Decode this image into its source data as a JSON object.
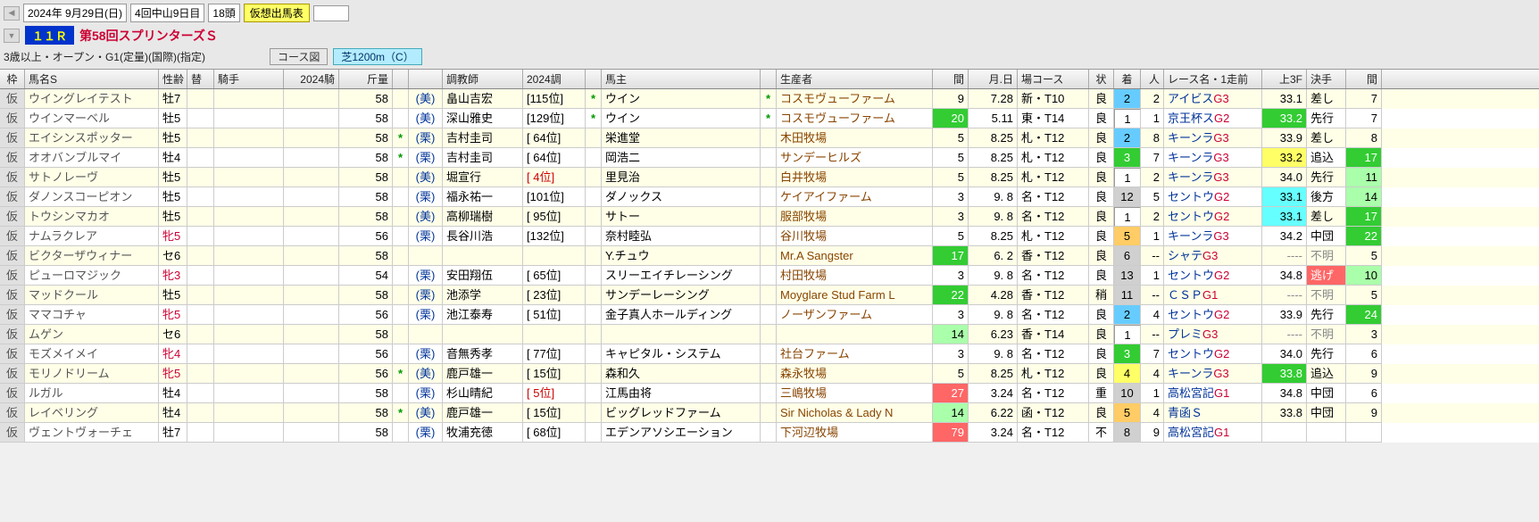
{
  "header": {
    "date": "2024年 9月29日(日)",
    "meeting": "4回中山9日目",
    "horses": "18頭",
    "badge": "仮想出馬表",
    "race_num": "１１Ｒ",
    "race_name": "第58回スプリンターズＳ",
    "race_cond": "3歳以上・オープン・G1(定量)(国際)(指定)",
    "course_btn": "コース図",
    "course": "芝1200m（C）"
  },
  "columns": {
    "waku": "枠",
    "name": "馬名S",
    "sexage": "性齢",
    "chg": "替",
    "jockey": "騎手",
    "jrank": "2024騎",
    "weight": "斤量",
    "trainer": "調教師",
    "trank": "2024調",
    "owner": "馬主",
    "breeder": "生産者",
    "gap": "間",
    "date": "月.日",
    "course": "場コース",
    "cond": "状",
    "fin": "着",
    "pop": "人",
    "race": "レース名・1走前",
    "f3": "上3F",
    "style": "決手",
    "gap2": "間"
  },
  "rows": [
    {
      "name": "ウイングレイテスト",
      "sex": "牡7",
      "wt": "58",
      "star1": "",
      "loc": "(美)",
      "tr": "畠山吉宏",
      "trk": "[115位]",
      "star2": "*",
      "own": "ウイン",
      "star3": "*",
      "brd": "コスモヴューファーム",
      "gap": "9",
      "gapc": "",
      "date": "7.28",
      "crs": "新・T10",
      "cond": "良",
      "fin": "2",
      "finc": "fin-2",
      "pop": "2",
      "race": "アイビス",
      "rg": "G3",
      "f3": "33.1",
      "f3c": "f3-plain",
      "sty": "差し",
      "styc": "",
      "g2": "7",
      "g2c": ""
    },
    {
      "name": "ウインマーベル",
      "sex": "牡5",
      "wt": "58",
      "star1": "",
      "loc": "(美)",
      "tr": "深山雅史",
      "trk": "[129位]",
      "star2": "*",
      "own": "ウイン",
      "star3": "*",
      "brd": "コスモヴューファーム",
      "gap": "20",
      "gapc": "bg-green",
      "date": "5.11",
      "crs": "東・T14",
      "cond": "良",
      "fin": "1",
      "finc": "fin-1",
      "pop": "1",
      "race": "京王杯ス",
      "rg": "G2",
      "f3": "33.2",
      "f3c": "f3-green",
      "sty": "先行",
      "styc": "",
      "g2": "7",
      "g2c": ""
    },
    {
      "name": "エイシンスポッター",
      "sex": "牡5",
      "wt": "58",
      "star1": "*",
      "loc": "(栗)",
      "tr": "吉村圭司",
      "trk": "[ 64位]",
      "star2": "",
      "own": "栄進堂",
      "star3": "",
      "brd": "木田牧場",
      "gap": "5",
      "gapc": "",
      "date": "8.25",
      "crs": "札・T12",
      "cond": "良",
      "fin": "2",
      "finc": "fin-2",
      "pop": "8",
      "race": "キーンラ",
      "rg": "G3",
      "f3": "33.9",
      "f3c": "f3-plain",
      "sty": "差し",
      "styc": "",
      "g2": "8",
      "g2c": ""
    },
    {
      "name": "オオバンブルマイ",
      "sex": "牡4",
      "wt": "58",
      "star1": "*",
      "loc": "(栗)",
      "tr": "吉村圭司",
      "trk": "[ 64位]",
      "star2": "",
      "own": "岡浩二",
      "star3": "",
      "brd": "サンデーヒルズ",
      "gap": "5",
      "gapc": "",
      "date": "8.25",
      "crs": "札・T12",
      "cond": "良",
      "fin": "3",
      "finc": "fin-3",
      "pop": "7",
      "race": "キーンラ",
      "rg": "G3",
      "f3": "33.2",
      "f3c": "f3-yellow",
      "sty": "追込",
      "styc": "",
      "g2": "17",
      "g2c": "g2-dgreen"
    },
    {
      "name": "サトノレーヴ",
      "sex": "牡5",
      "wt": "58",
      "star1": "",
      "loc": "(美)",
      "tr": "堀宣行",
      "trk": "[  4位]",
      "trkc": "trank-red",
      "star2": "",
      "own": "里見治",
      "star3": "",
      "brd": "白井牧場",
      "gap": "5",
      "gapc": "",
      "date": "8.25",
      "crs": "札・T12",
      "cond": "良",
      "fin": "1",
      "finc": "fin-1",
      "pop": "2",
      "race": "キーンラ",
      "rg": "G3",
      "f3": "34.0",
      "f3c": "f3-plain",
      "sty": "先行",
      "styc": "",
      "g2": "11",
      "g2c": "g2-green"
    },
    {
      "name": "ダノンスコーピオン",
      "sex": "牡5",
      "wt": "58",
      "star1": "",
      "loc": "(栗)",
      "tr": "福永祐一",
      "trk": "[101位]",
      "star2": "",
      "own": "ダノックス",
      "star3": "",
      "brd": "ケイアイファーム",
      "gap": "3",
      "gapc": "",
      "date": "9. 8",
      "crs": "名・T12",
      "cond": "良",
      "fin": "12",
      "finc": "fin-other",
      "pop": "5",
      "race": "セントウ",
      "rg": "G2",
      "f3": "33.1",
      "f3c": "f3-cyan",
      "sty": "後方",
      "styc": "",
      "g2": "14",
      "g2c": "g2-green"
    },
    {
      "name": "トウシンマカオ",
      "sex": "牡5",
      "wt": "58",
      "star1": "",
      "loc": "(美)",
      "tr": "高柳瑞樹",
      "trk": "[ 95位]",
      "star2": "",
      "own": "サトー",
      "star3": "",
      "brd": "服部牧場",
      "gap": "3",
      "gapc": "",
      "date": "9. 8",
      "crs": "名・T12",
      "cond": "良",
      "fin": "1",
      "finc": "fin-1",
      "pop": "2",
      "race": "セントウ",
      "rg": "G2",
      "f3": "33.1",
      "f3c": "f3-cyan",
      "sty": "差し",
      "styc": "",
      "g2": "17",
      "g2c": "g2-dgreen"
    },
    {
      "name": "ナムラクレア",
      "sex": "牝5",
      "sexc": "sex-f",
      "wt": "56",
      "star1": "",
      "loc": "(栗)",
      "tr": "長谷川浩",
      "trk": "[132位]",
      "star2": "",
      "own": "奈村睦弘",
      "star3": "",
      "brd": "谷川牧場",
      "gap": "5",
      "gapc": "",
      "date": "8.25",
      "crs": "札・T12",
      "cond": "良",
      "fin": "5",
      "finc": "fin-5",
      "pop": "1",
      "race": "キーンラ",
      "rg": "G3",
      "f3": "34.2",
      "f3c": "f3-plain",
      "sty": "中団",
      "styc": "",
      "g2": "22",
      "g2c": "g2-dgreen"
    },
    {
      "name": "ビクターザウィナー",
      "sex": "セ6",
      "wt": "58",
      "star1": "",
      "loc": "",
      "tr": "",
      "trk": "",
      "star2": "",
      "own": "Y.チュウ",
      "star3": "",
      "brd": "Mr.A Sangster",
      "gap": "17",
      "gapc": "bg-green",
      "date": "6. 2",
      "crs": "香・T12",
      "cond": "良",
      "fin": "6",
      "finc": "fin-other",
      "pop": "--",
      "race": "シャテ",
      "rg": "G3",
      "f3": "----",
      "f3c": "f3-none",
      "sty": "不明",
      "styc": "style-unknown",
      "g2": "5",
      "g2c": ""
    },
    {
      "name": "ピューロマジック",
      "sex": "牝3",
      "sexc": "sex-f",
      "wt": "54",
      "star1": "",
      "loc": "(栗)",
      "tr": "安田翔伍",
      "trk": "[ 65位]",
      "star2": "",
      "own": "スリーエイチレーシング",
      "star3": "",
      "brd": "村田牧場",
      "gap": "3",
      "gapc": "",
      "date": "9. 8",
      "crs": "名・T12",
      "cond": "良",
      "fin": "13",
      "finc": "fin-other",
      "pop": "1",
      "race": "セントウ",
      "rg": "G2",
      "f3": "34.8",
      "f3c": "f3-plain",
      "sty": "逃げ",
      "styc": "s-nige",
      "g2": "10",
      "g2c": "g2-green"
    },
    {
      "name": "マッドクール",
      "sex": "牡5",
      "wt": "58",
      "star1": "",
      "loc": "(栗)",
      "tr": "池添学",
      "trk": "[ 23位]",
      "star2": "",
      "own": "サンデーレーシング",
      "star3": "",
      "brd": "Moyglare Stud Farm L",
      "gap": "22",
      "gapc": "bg-green",
      "date": "4.28",
      "crs": "香・T12",
      "cond": "稍",
      "fin": "11",
      "finc": "fin-other",
      "pop": "--",
      "race": "ＣＳＰ",
      "rg": "G1",
      "f3": "----",
      "f3c": "f3-none",
      "sty": "不明",
      "styc": "style-unknown",
      "g2": "5",
      "g2c": ""
    },
    {
      "name": "ママコチャ",
      "sex": "牝5",
      "sexc": "sex-f",
      "wt": "56",
      "star1": "",
      "loc": "(栗)",
      "tr": "池江泰寿",
      "trk": "[ 51位]",
      "star2": "",
      "own": "金子真人ホールディング",
      "star3": "",
      "brd": "ノーザンファーム",
      "gap": "3",
      "gapc": "",
      "date": "9. 8",
      "crs": "名・T12",
      "cond": "良",
      "fin": "2",
      "finc": "fin-2",
      "pop": "4",
      "race": "セントウ",
      "rg": "G2",
      "f3": "33.9",
      "f3c": "f3-plain",
      "sty": "先行",
      "styc": "",
      "g2": "24",
      "g2c": "g2-dgreen"
    },
    {
      "name": "ムゲン",
      "sex": "セ6",
      "wt": "58",
      "star1": "",
      "loc": "",
      "tr": "",
      "trk": "",
      "star2": "",
      "own": "",
      "star3": "",
      "brd": "",
      "gap": "14",
      "gapc": "bg-lgreen",
      "date": "6.23",
      "crs": "香・T14",
      "cond": "良",
      "fin": "1",
      "finc": "fin-1",
      "pop": "--",
      "race": "プレミ",
      "rg": "G3",
      "f3": "----",
      "f3c": "f3-none",
      "sty": "不明",
      "styc": "style-unknown",
      "g2": "3",
      "g2c": ""
    },
    {
      "name": "モズメイメイ",
      "sex": "牝4",
      "sexc": "sex-f",
      "wt": "56",
      "star1": "",
      "loc": "(栗)",
      "tr": "音無秀孝",
      "trk": "[ 77位]",
      "star2": "",
      "own": "キャピタル・システム",
      "star3": "",
      "brd": "社台ファーム",
      "gap": "3",
      "gapc": "",
      "date": "9. 8",
      "crs": "名・T12",
      "cond": "良",
      "fin": "3",
      "finc": "fin-3",
      "pop": "7",
      "race": "セントウ",
      "rg": "G2",
      "f3": "34.0",
      "f3c": "f3-plain",
      "sty": "先行",
      "styc": "",
      "g2": "6",
      "g2c": ""
    },
    {
      "name": "モリノドリーム",
      "sex": "牝5",
      "sexc": "sex-f",
      "wt": "56",
      "star1": "*",
      "loc": "(美)",
      "tr": "鹿戸雄一",
      "trk": "[ 15位]",
      "star2": "",
      "own": "森和久",
      "star3": "",
      "brd": "森永牧場",
      "gap": "5",
      "gapc": "",
      "date": "8.25",
      "crs": "札・T12",
      "cond": "良",
      "fin": "4",
      "finc": "fin-4",
      "pop": "4",
      "race": "キーンラ",
      "rg": "G3",
      "f3": "33.8",
      "f3c": "f3-green",
      "sty": "追込",
      "styc": "",
      "g2": "9",
      "g2c": ""
    },
    {
      "name": "ルガル",
      "sex": "牡4",
      "wt": "58",
      "star1": "",
      "loc": "(栗)",
      "tr": "杉山晴紀",
      "trk": "[  5位]",
      "trkc": "trank-red",
      "star2": "",
      "own": "江馬由将",
      "star3": "",
      "brd": "三嶋牧場",
      "gap": "27",
      "gapc": "bg-red",
      "date": "3.24",
      "crs": "名・T12",
      "cond": "重",
      "fin": "10",
      "finc": "fin-other",
      "pop": "1",
      "race": "高松宮記",
      "rg": "G1",
      "f3": "34.8",
      "f3c": "f3-plain",
      "sty": "中団",
      "styc": "",
      "g2": "6",
      "g2c": ""
    },
    {
      "name": "レイベリング",
      "sex": "牡4",
      "wt": "58",
      "star1": "*",
      "loc": "(美)",
      "tr": "鹿戸雄一",
      "trk": "[ 15位]",
      "star2": "",
      "own": "ビッグレッドファーム",
      "star3": "",
      "brd": "Sir Nicholas & Lady N",
      "gap": "14",
      "gapc": "bg-lgreen",
      "date": "6.22",
      "crs": "函・T12",
      "cond": "良",
      "fin": "5",
      "finc": "fin-5",
      "pop": "4",
      "race": "青函Ｓ",
      "rg": "",
      "f3": "33.8",
      "f3c": "f3-plain",
      "sty": "中団",
      "styc": "",
      "g2": "9",
      "g2c": ""
    },
    {
      "name": "ヴェントヴォーチェ",
      "sex": "牡7",
      "wt": "58",
      "star1": "",
      "loc": "(栗)",
      "tr": "牧浦充徳",
      "trk": "[ 68位]",
      "star2": "",
      "own": "エデンアソシエーション",
      "star3": "",
      "brd": "下河辺牧場",
      "gap": "79",
      "gapc": "bg-red",
      "date": "3.24",
      "crs": "名・T12",
      "cond": "不",
      "fin": "8",
      "finc": "fin-other",
      "pop": "9",
      "race": "高松宮記",
      "rg": "G1",
      "f3": "",
      "f3c": "",
      "sty": "",
      "styc": "",
      "g2": "",
      "g2c": ""
    }
  ]
}
